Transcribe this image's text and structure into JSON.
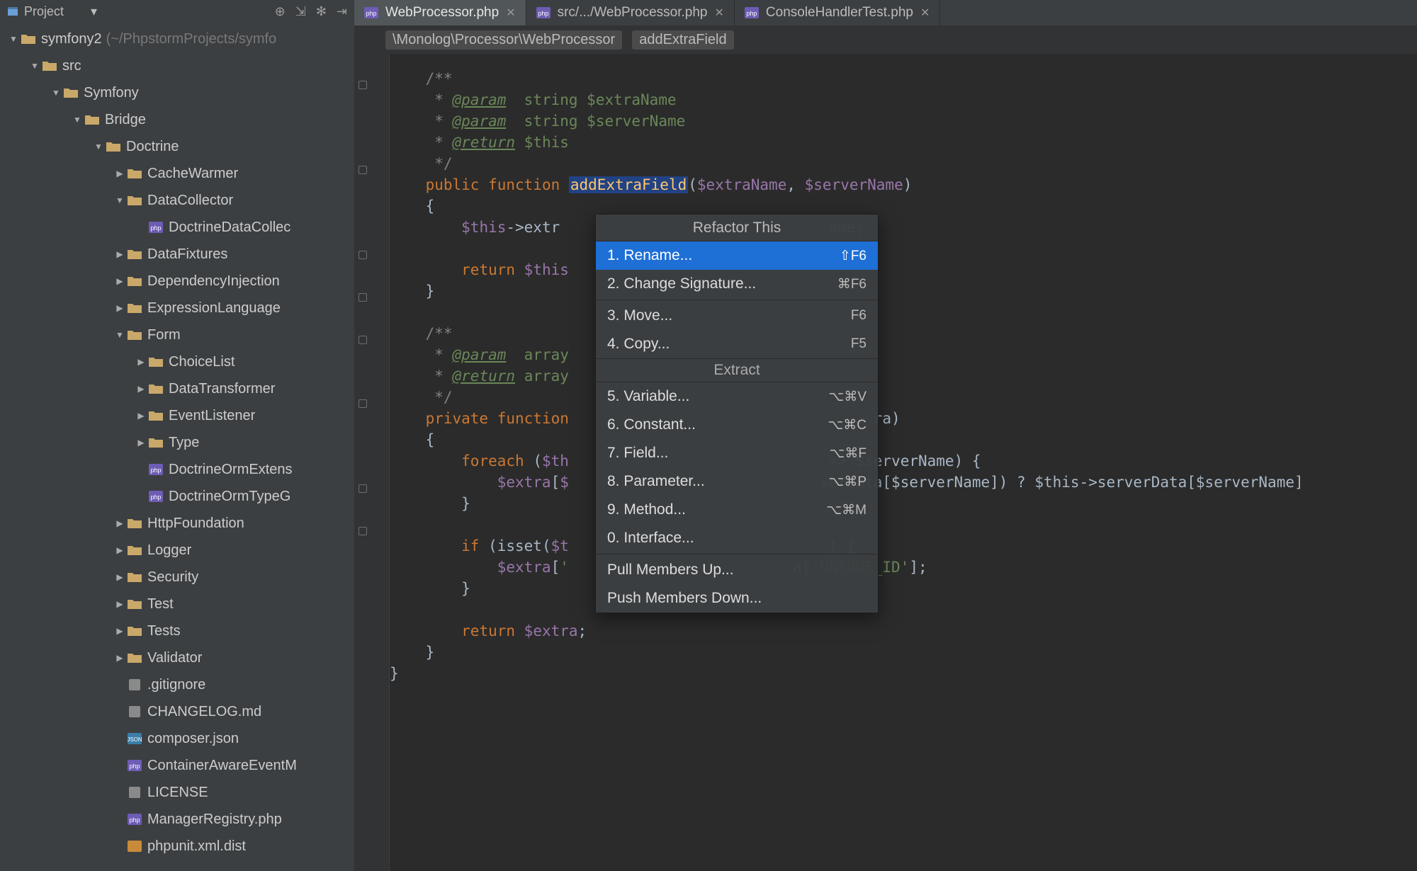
{
  "project_label": "Project",
  "root": {
    "name": "symfony2",
    "path": "(~/PhpstormProjects/symfo"
  },
  "tree": [
    {
      "d": 0,
      "tw": "down",
      "ic": "folder",
      "label": "symfony2",
      "hint": "(~/PhpstormProjects/symfo"
    },
    {
      "d": 1,
      "tw": "down",
      "ic": "folder",
      "label": "src"
    },
    {
      "d": 2,
      "tw": "down",
      "ic": "folder",
      "label": "Symfony"
    },
    {
      "d": 3,
      "tw": "down",
      "ic": "folder",
      "label": "Bridge"
    },
    {
      "d": 4,
      "tw": "down",
      "ic": "folder",
      "label": "Doctrine"
    },
    {
      "d": 5,
      "tw": "right",
      "ic": "folder",
      "label": "CacheWarmer"
    },
    {
      "d": 5,
      "tw": "down",
      "ic": "folder",
      "label": "DataCollector"
    },
    {
      "d": 6,
      "tw": "",
      "ic": "php",
      "label": "DoctrineDataCollec"
    },
    {
      "d": 5,
      "tw": "right",
      "ic": "folder",
      "label": "DataFixtures"
    },
    {
      "d": 5,
      "tw": "right",
      "ic": "folder",
      "label": "DependencyInjection"
    },
    {
      "d": 5,
      "tw": "right",
      "ic": "folder",
      "label": "ExpressionLanguage"
    },
    {
      "d": 5,
      "tw": "down",
      "ic": "folder",
      "label": "Form"
    },
    {
      "d": 6,
      "tw": "right",
      "ic": "folder",
      "label": "ChoiceList"
    },
    {
      "d": 6,
      "tw": "right",
      "ic": "folder",
      "label": "DataTransformer"
    },
    {
      "d": 6,
      "tw": "right",
      "ic": "folder",
      "label": "EventListener"
    },
    {
      "d": 6,
      "tw": "right",
      "ic": "folder",
      "label": "Type"
    },
    {
      "d": 6,
      "tw": "",
      "ic": "php",
      "label": "DoctrineOrmExtens"
    },
    {
      "d": 6,
      "tw": "",
      "ic": "php",
      "label": "DoctrineOrmTypeG"
    },
    {
      "d": 5,
      "tw": "right",
      "ic": "folder",
      "label": "HttpFoundation"
    },
    {
      "d": 5,
      "tw": "right",
      "ic": "folder",
      "label": "Logger"
    },
    {
      "d": 5,
      "tw": "right",
      "ic": "folder",
      "label": "Security"
    },
    {
      "d": 5,
      "tw": "right",
      "ic": "folder",
      "label": "Test"
    },
    {
      "d": 5,
      "tw": "right",
      "ic": "folder",
      "label": "Tests"
    },
    {
      "d": 5,
      "tw": "right",
      "ic": "folder",
      "label": "Validator"
    },
    {
      "d": 5,
      "tw": "",
      "ic": "txt",
      "label": ".gitignore"
    },
    {
      "d": 5,
      "tw": "",
      "ic": "txt",
      "label": "CHANGELOG.md"
    },
    {
      "d": 5,
      "tw": "",
      "ic": "json",
      "label": "composer.json"
    },
    {
      "d": 5,
      "tw": "",
      "ic": "php",
      "label": "ContainerAwareEventM"
    },
    {
      "d": 5,
      "tw": "",
      "ic": "txt",
      "label": "LICENSE"
    },
    {
      "d": 5,
      "tw": "",
      "ic": "php",
      "label": "ManagerRegistry.php"
    },
    {
      "d": 5,
      "tw": "",
      "ic": "xml",
      "label": "phpunit.xml.dist"
    }
  ],
  "tabs": [
    {
      "label": "WebProcessor.php",
      "active": true
    },
    {
      "label": "src/.../WebProcessor.php",
      "active": false
    },
    {
      "label": "ConsoleHandlerTest.php",
      "active": false
    }
  ],
  "crumbs": {
    "path": "\\Monolog\\Processor\\WebProcessor",
    "member": "addExtraField"
  },
  "ctx": {
    "title": "Refactor This",
    "items": [
      {
        "label": "1. Rename...",
        "shortcut": "⇧F6",
        "highlight": true
      },
      {
        "label": "2. Change Signature...",
        "shortcut": "⌘F6"
      },
      {
        "sep": true
      },
      {
        "label": "3. Move...",
        "shortcut": "F6"
      },
      {
        "label": "4. Copy...",
        "shortcut": "F5"
      },
      {
        "section": "Extract"
      },
      {
        "label": "5. Variable...",
        "shortcut": "⌥⌘V"
      },
      {
        "label": "6. Constant...",
        "shortcut": "⌥⌘C"
      },
      {
        "label": "7. Field...",
        "shortcut": "⌥⌘F"
      },
      {
        "label": "8. Parameter...",
        "shortcut": "⌥⌘P"
      },
      {
        "label": "9. Method...",
        "shortcut": "⌥⌘M"
      },
      {
        "label": "0. Interface..."
      },
      {
        "sep": true
      },
      {
        "label": "Pull Members Up..."
      },
      {
        "label": "Push Members Down..."
      }
    ]
  },
  "code": {
    "fn_name": "addExtraField",
    "param1": "string $extraName",
    "param2": "string $serverName",
    "ret": "$this",
    "call_var": "$extraName",
    "call_var2": "$serverName",
    "line_assign_tail": "ame;",
    "arr_var": "array",
    "foreach_tail": "  => $serverName) {",
    "inner_tail": "verData[$serverName]) ? $this->serverData[$serverName]",
    "unique": "'UNIQUE_ID'",
    "isset_tail": ") {",
    "return_extra": "$extra"
  }
}
